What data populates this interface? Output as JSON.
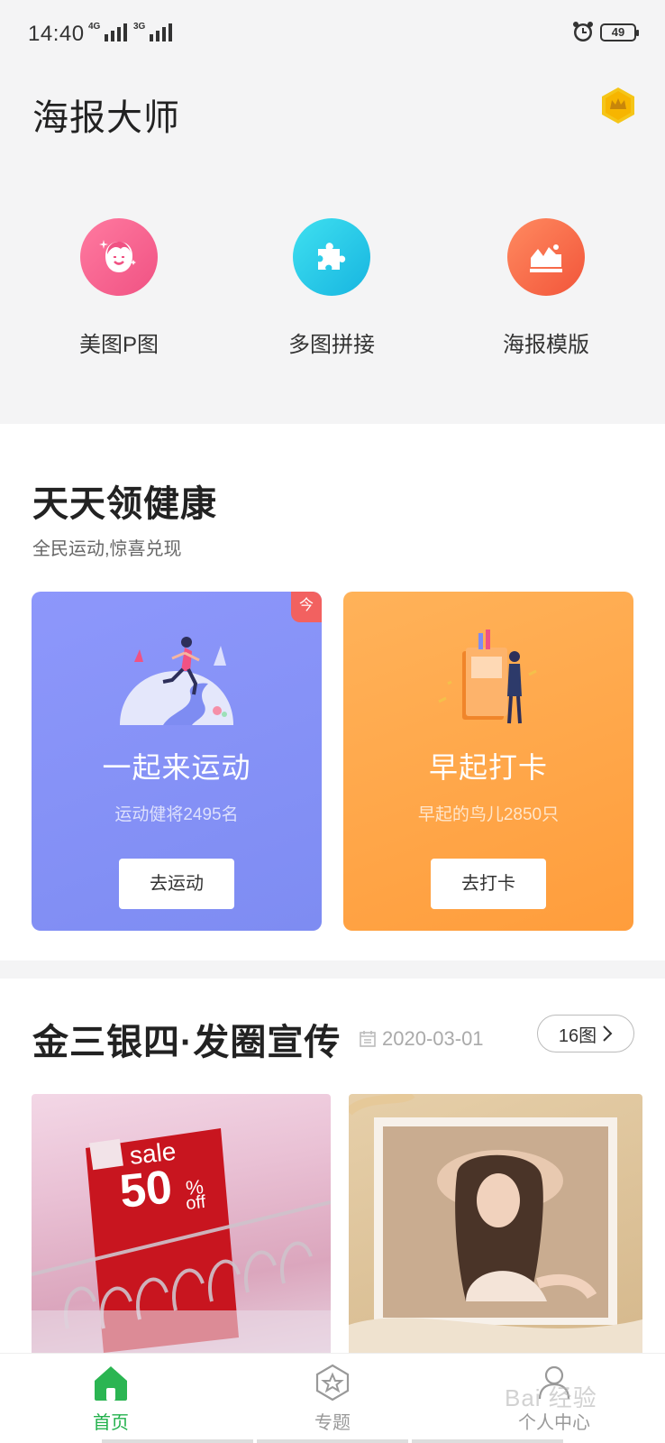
{
  "status_bar": {
    "time": "14:40",
    "network_1": "4G",
    "network_2": "3G",
    "battery": "49"
  },
  "header": {
    "title": "海报大师",
    "vip_icon": "crown-hexagon-icon"
  },
  "tools": [
    {
      "label": "美图P图",
      "icon": "face-sparkle-icon",
      "color": "#f05283"
    },
    {
      "label": "多图拼接",
      "icon": "puzzle-icon",
      "color": "#17b5e0"
    },
    {
      "label": "海报模版",
      "icon": "picture-mountain-icon",
      "color": "#f2553a"
    }
  ],
  "health_section": {
    "title": "天天领健康",
    "subtitle": "全民运动,惊喜兑现",
    "cards": [
      {
        "badge": "今",
        "title": "一起来运动",
        "subtitle": "运动健将2495名",
        "button": "去运动",
        "color": "#8d97fb"
      },
      {
        "title": "早起打卡",
        "subtitle": "早起的鸟儿2850只",
        "button": "去打卡",
        "color": "#ffb259"
      }
    ]
  },
  "promo_section": {
    "title": "金三银四·发圈宣传",
    "date": "2020-03-01",
    "count_button": "16图",
    "photo_1_text": {
      "line1": "sale",
      "line2": "50",
      "line3": "%",
      "line4": "off"
    }
  },
  "tab_bar": {
    "tabs": [
      {
        "label": "首页",
        "icon": "home-icon",
        "active": true
      },
      {
        "label": "专题",
        "icon": "star-badge-icon",
        "active": false
      },
      {
        "label": "个人中心",
        "icon": "user-icon",
        "active": false
      }
    ]
  },
  "watermark": "Bai 经验"
}
